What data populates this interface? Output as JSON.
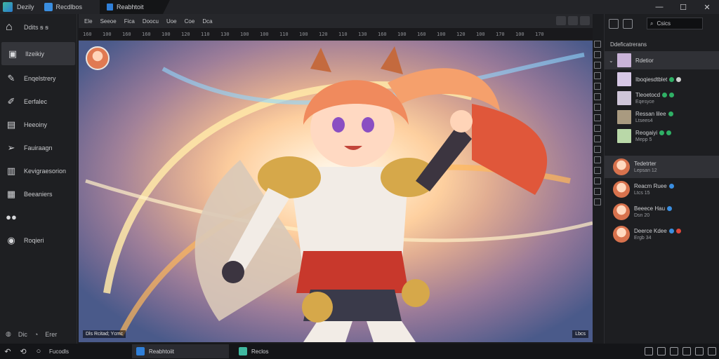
{
  "window": {
    "app_name": "Dezily",
    "file_label": "Recdlbos",
    "active_tab": "Reabhtoit",
    "controls": [
      "—",
      "☐",
      "✕"
    ]
  },
  "sidebar": {
    "home_label": "Ddits ꞩ ꞩ",
    "items": [
      {
        "label": "Ilzeikiy",
        "icon": "image-icon",
        "active": true
      },
      {
        "label": "Enqelstrery",
        "icon": "brush-icon",
        "active": false
      },
      {
        "label": "Eerfalec",
        "icon": "pen-icon",
        "active": false
      },
      {
        "label": "Heeoiny",
        "icon": "layers-icon",
        "active": false
      },
      {
        "label": "Fauiraagn",
        "icon": "send-icon",
        "active": false
      },
      {
        "label": "Kevigraesorion",
        "icon": "chart-icon",
        "active": false
      },
      {
        "label": "Beeaniers",
        "icon": "grid-icon",
        "active": false
      },
      {
        "label": "",
        "icon": "link-icon",
        "active": false
      },
      {
        "label": "Roqieri",
        "icon": "settings-icon",
        "active": false
      }
    ],
    "bottom_labels": [
      "Dic",
      "Erer"
    ]
  },
  "toolbar": {
    "menu": [
      "Ele",
      "Seeoe",
      "Fica",
      "Doocu",
      "Uoe",
      "Coe",
      "Dca"
    ]
  },
  "ruler": {
    "ticks": [
      "160",
      "100",
      "160",
      "160",
      "100",
      "120",
      "110",
      "130",
      "100",
      "100",
      "110",
      "100",
      "120",
      "110",
      "130",
      "160",
      "100",
      "160",
      "100",
      "120",
      "100",
      "170",
      "100",
      "170"
    ]
  },
  "canvas": {
    "caption": "Dls Rcitad; Ycmc",
    "corner": "Lbcs"
  },
  "right_panel": {
    "search_placeholder": "Csics",
    "header": "Ddeficatrerans",
    "layers": [
      {
        "name": "Rdetior",
        "sub": "",
        "thumb": "#c9b3d8",
        "selected": true,
        "dots": []
      },
      {
        "name": "Iboqiesdtblet",
        "sub": "",
        "thumb": "#d7c8e6",
        "selected": false,
        "dots": [
          "#2fb065",
          "#d0d0d0"
        ]
      },
      {
        "name": "Tleoetocd",
        "sub": "Eqesyce",
        "thumb": "#cfc6d9",
        "selected": false,
        "dots": [
          "#2fb065",
          "#2fb065",
          "#2fb065"
        ]
      },
      {
        "name": "Ressan lilee",
        "sub": "Ltsees4",
        "thumb": "#a99a80",
        "selected": false,
        "dots": [
          "#2fb065"
        ]
      },
      {
        "name": "Reogaiyi",
        "sub": "Mepp 5",
        "thumb": "#b9d8a8",
        "selected": false,
        "dots": [
          "#2fb065",
          "#2fb065"
        ]
      }
    ],
    "members": [
      {
        "name": "Tedetrter",
        "sub": "Lepsan 12",
        "selected": true,
        "dots": []
      },
      {
        "name": "Reacm Ruee",
        "sub": "Ltcs 15",
        "selected": false,
        "dots": [
          "#3a8ee0"
        ]
      },
      {
        "name": "Beeece Hau",
        "sub": "Dsn 20",
        "selected": false,
        "dots": [
          "#3a8ee0"
        ]
      },
      {
        "name": "Deerce Kdee",
        "sub": "Ergb 34",
        "selected": false,
        "dots": [
          "#3a8ee0",
          "#e0483a"
        ]
      }
    ]
  },
  "taskbar": {
    "start_label": "Fucodls",
    "tasks": [
      {
        "label": "Reabhtoiit",
        "color": "#2f7fd8",
        "active": true
      },
      {
        "label": "Reclos",
        "color": "#3fb8a0",
        "active": false
      }
    ]
  },
  "colors": {
    "background": "#1b1c1f",
    "panel": "#1e1f22",
    "selection": "#303136",
    "accent": "#2f7fd8"
  }
}
